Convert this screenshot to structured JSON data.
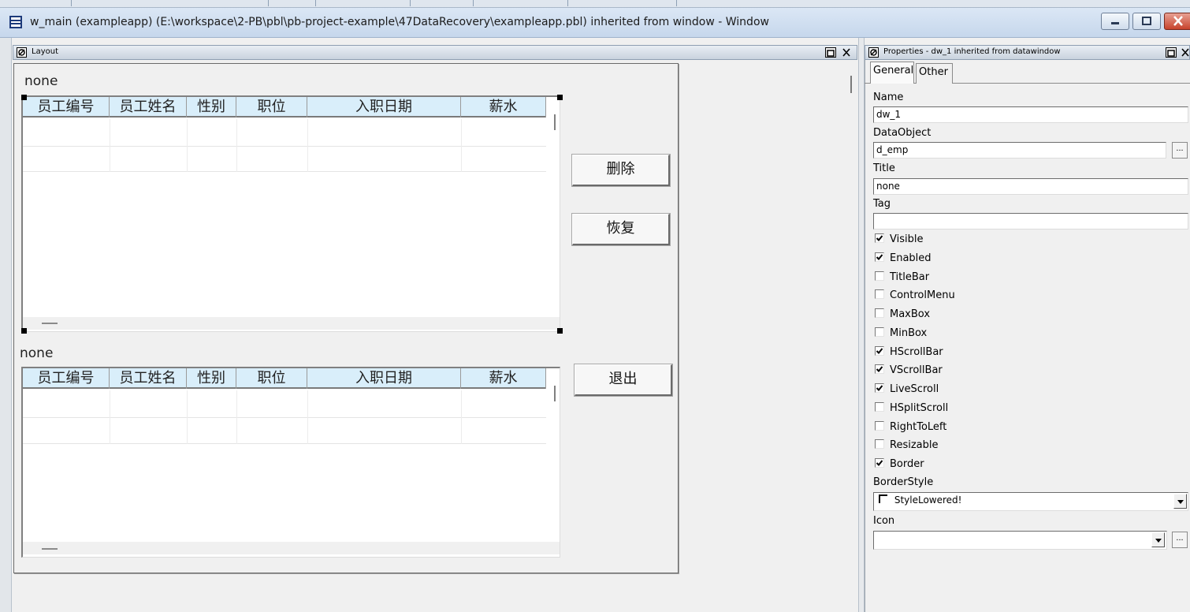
{
  "window": {
    "title": "w_main (exampleapp) (E:\\workspace\\2-PB\\pbl\\pb-project-example\\47DataRecovery\\exampleapp.pbl) inherited from window - Window"
  },
  "layout_pane": {
    "title": "Layout",
    "dw1": {
      "title": "none",
      "columns": [
        "员工编号",
        "员工姓名",
        "性别",
        "职位",
        "入职日期",
        "薪水"
      ]
    },
    "dw2": {
      "title": "none",
      "columns": [
        "员工编号",
        "员工姓名",
        "性别",
        "职位",
        "入职日期",
        "薪水"
      ]
    },
    "buttons": {
      "delete": "删除",
      "restore": "恢复",
      "exit": "退出"
    }
  },
  "properties_pane": {
    "title": "Properties - dw_1 inherited from datawindow",
    "tabs": [
      "General",
      "Other"
    ],
    "name_label": "Name",
    "name_value": "dw_1",
    "dataobject_label": "DataObject",
    "dataobject_value": "d_emp",
    "title_label": "Title",
    "title_value": "none",
    "tag_label": "Tag",
    "tag_value": "",
    "checkboxes": [
      {
        "label": "Visible",
        "checked": true
      },
      {
        "label": "Enabled",
        "checked": true
      },
      {
        "label": "TitleBar",
        "checked": false
      },
      {
        "label": "ControlMenu",
        "checked": false
      },
      {
        "label": "MaxBox",
        "checked": false
      },
      {
        "label": "MinBox",
        "checked": false
      },
      {
        "label": "HScrollBar",
        "checked": true
      },
      {
        "label": "VScrollBar",
        "checked": true
      },
      {
        "label": "LiveScroll",
        "checked": true
      },
      {
        "label": "HSplitScroll",
        "checked": false
      },
      {
        "label": "RightToLeft",
        "checked": false
      },
      {
        "label": "Resizable",
        "checked": false
      },
      {
        "label": "Border",
        "checked": true
      }
    ],
    "borderstyle_label": "BorderStyle",
    "borderstyle_value": "StyleLowered!",
    "icon_label": "Icon",
    "icon_value": "",
    "ellipsis": "..."
  }
}
